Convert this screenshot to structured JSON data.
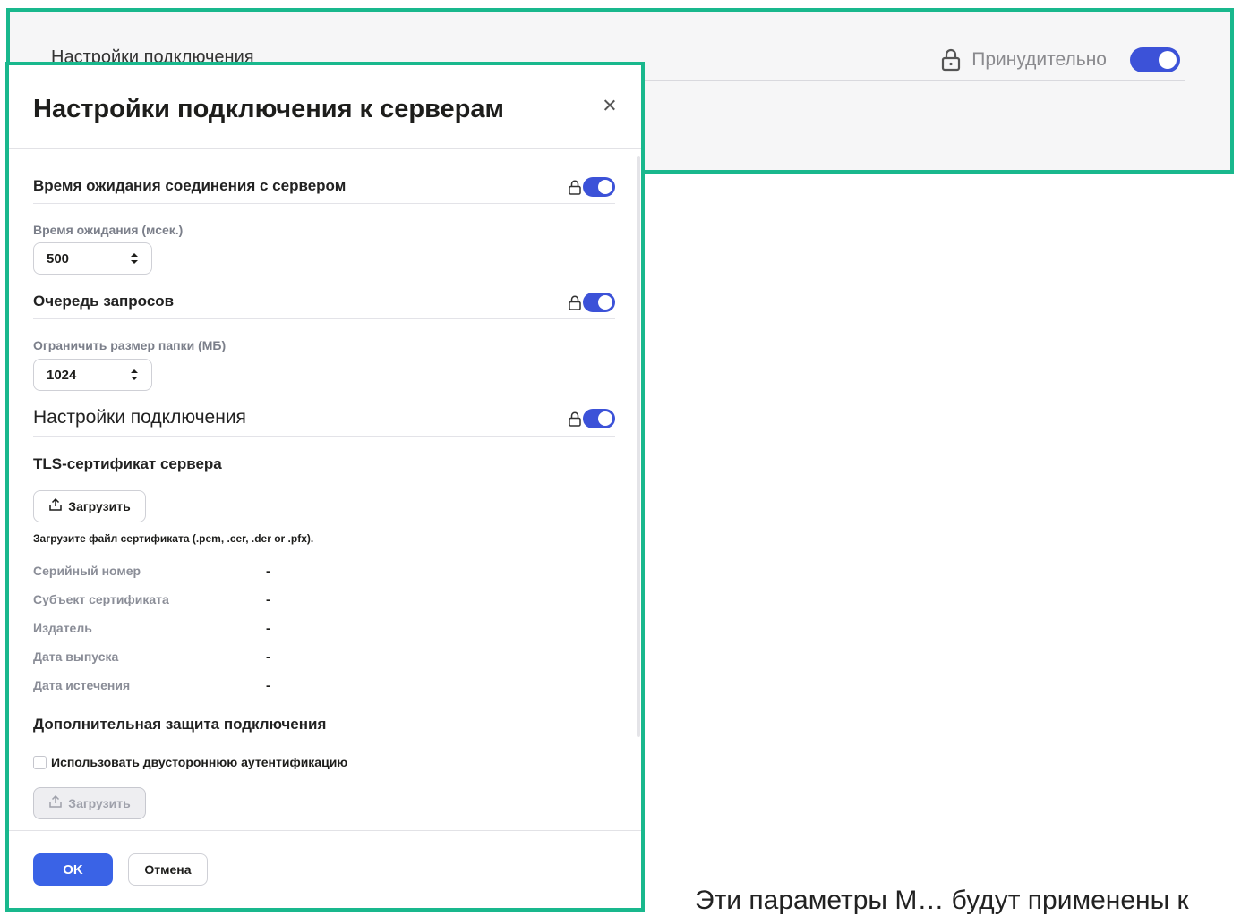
{
  "background": {
    "title": "Настройки подключения",
    "forced_label": "Принудительно",
    "forced_toggle": "on",
    "bottom_text": "Эти параметры М… будут применены к"
  },
  "dialog": {
    "title": "Настройки подключения к серверам",
    "timeout_section": {
      "label": "Время ожидания соединения с сервером",
      "field_label": "Время ожидания (мсек.)",
      "value": "500"
    },
    "queue_section": {
      "label": "Очередь запросов",
      "field_label": "Ограничить размер папки (МБ)",
      "value": "1024"
    },
    "connection_section": {
      "label": "Настройки подключения",
      "tls_title": "TLS-сертификат сервера",
      "upload_label": "Загрузить",
      "hint": "Загрузите файл сертификата (.pem, .cer, .der or .pfx).",
      "info": [
        {
          "key": "Серийный номер",
          "value": "-"
        },
        {
          "key": "Субъект сертификата",
          "value": "-"
        },
        {
          "key": "Издатель",
          "value": "-"
        },
        {
          "key": "Дата выпуска",
          "value": "-"
        },
        {
          "key": "Дата истечения",
          "value": "-"
        }
      ],
      "extra_title": "Дополнительная защита подключения",
      "mutual_auth_label": "Использовать двустороннюю аутентификацию",
      "mutual_auth_checked": false,
      "upload2_label": "Загрузить"
    },
    "footer": {
      "ok_label": "OK",
      "cancel_label": "Отмена"
    }
  },
  "colors": {
    "accent": "#19b88d",
    "toggle": "#3c52d8",
    "primary_button": "#3a63e6"
  }
}
